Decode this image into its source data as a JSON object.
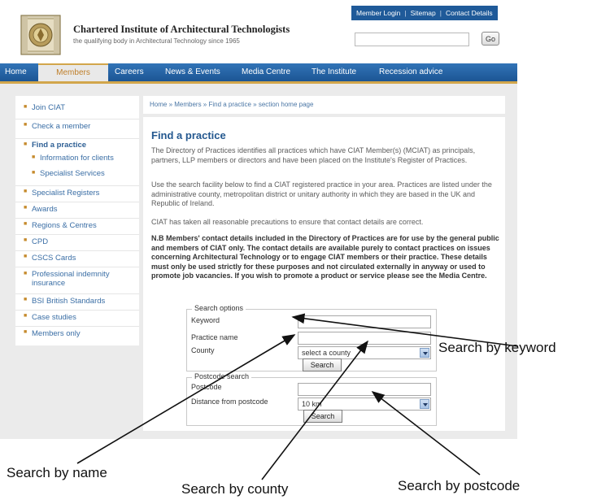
{
  "header": {
    "institute_name": "Chartered Institute of Architectural Technologists",
    "tagline": "the qualifying body in Architectural Technology since 1965",
    "utility_links": [
      "Member Login",
      "Sitemap",
      "Contact Details"
    ],
    "search": {
      "value": "",
      "button": "Go"
    }
  },
  "nav": {
    "items": [
      "Home",
      "Members",
      "Careers",
      "News & Events",
      "Media Centre",
      "The Institute",
      "Recession advice"
    ],
    "active": "Members"
  },
  "sidebar": {
    "items": [
      {
        "label": "Join CIAT"
      },
      {
        "label": "Check a member"
      },
      {
        "label": "Find a practice",
        "current": true
      },
      {
        "label": "Information for clients",
        "sub": true
      },
      {
        "label": "Specialist Services",
        "sub": true
      },
      {
        "label": "Specialist Registers"
      },
      {
        "label": "Awards"
      },
      {
        "label": "Regions & Centres"
      },
      {
        "label": "CPD"
      },
      {
        "label": "CSCS Cards"
      },
      {
        "label": "Professional indemnity insurance"
      },
      {
        "label": "BSI British Standards"
      },
      {
        "label": "Case studies"
      },
      {
        "label": "Members only"
      }
    ]
  },
  "breadcrumb": "Home » Members » Find a practice » section home page",
  "main": {
    "title": "Find a practice",
    "para1": "The Directory of Practices identifies all practices which have CIAT Member(s) (MCIAT) as principals, partners, LLP members or directors and have been placed on the Institute's Register of Practices.",
    "para2": "Use the search facility below to find a CIAT registered practice in your area. Practices are listed under the administrative county, metropolitan district or unitary authority in which they are based in the UK and Republic of Ireland.",
    "para3": "CIAT has taken all reasonable precautions to ensure that contact details are correct.",
    "para4": "N.B Members' contact details included in the Directory of Practices are for use by the general public and members of CIAT only. The contact details are available purely to contact practices on issues concerning Architectural Technology or to engage CIAT members or their practice. These details must only be used strictly for these purposes and not circulated externally in anyway or used to promote job vacancies. If you wish to promote a product or service please see the Media Centre."
  },
  "search_options": {
    "legend": "Search options",
    "keyword_label": "Keyword",
    "keyword_value": "",
    "name_label": "Practice name",
    "name_value": "",
    "county_label": "County",
    "county_selected": "select a county",
    "button": "Search"
  },
  "postcode_search": {
    "legend": "Postcode search",
    "postcode_label": "Postcode",
    "postcode_value": "",
    "distance_label": "Distance from postcode",
    "distance_selected": "10 km",
    "button": "Search"
  },
  "annotations": {
    "keyword": "Search by keyword",
    "name": "Search by name",
    "county": "Search by county",
    "postcode": "Search by postcode"
  },
  "colors": {
    "nav_blue": "#1c5594",
    "nav_active_text": "#bf7f2a",
    "link_blue": "#3a6ea5",
    "title_blue": "#24588f",
    "accent_gold": "#d2a64b"
  }
}
